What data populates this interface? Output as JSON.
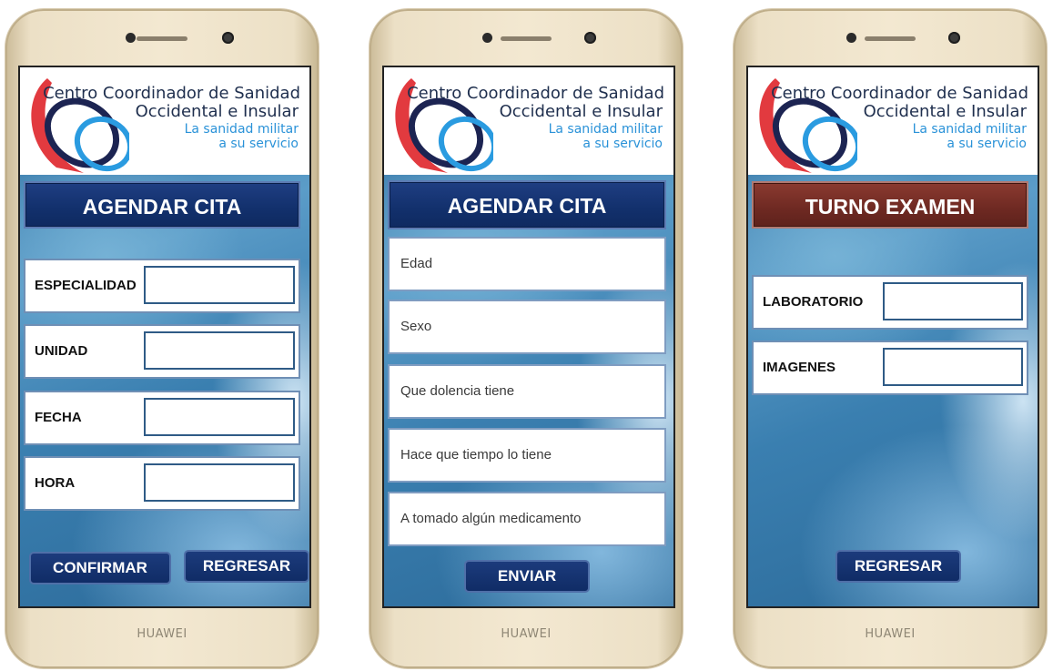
{
  "org": {
    "line1": "Centro Coordinador de Sanidad",
    "line2": "Occidental e Insular",
    "slogan1": "La sanidad militar",
    "slogan2": "a su servicio"
  },
  "device_brand": "HUAWEI",
  "screen1": {
    "title": "AGENDAR CITA",
    "fields": [
      {
        "label": "ESPECIALIDAD",
        "value": ""
      },
      {
        "label": "UNIDAD",
        "value": ""
      },
      {
        "label": "FECHA",
        "value": ""
      },
      {
        "label": "HORA",
        "value": ""
      }
    ],
    "confirm_label": "CONFIRMAR",
    "back_label": "REGRESAR"
  },
  "screen2": {
    "title": "AGENDAR CITA",
    "questions": [
      "Edad",
      "Sexo",
      "Que dolencia tiene",
      "Hace que tiempo lo tiene",
      "A tomado algún medicamento"
    ],
    "send_label": "ENVIAR"
  },
  "screen3": {
    "title": "TURNO EXAMEN",
    "fields": [
      {
        "label": "LABORATORIO",
        "value": ""
      },
      {
        "label": "IMAGENES",
        "value": ""
      }
    ],
    "back_label": "REGRESAR"
  },
  "colors": {
    "title_blue": "#12306c",
    "title_red": "#6e2922",
    "slogan_blue": "#2a92d8",
    "frame_gold": "#ece0c6"
  }
}
